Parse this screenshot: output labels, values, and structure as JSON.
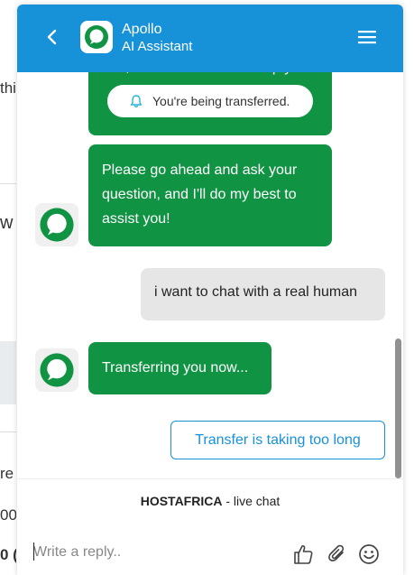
{
  "background_page": {
    "fragments": [
      "thi",
      "w",
      "re",
      "00",
      "0 ("
    ]
  },
  "header": {
    "title": "Apollo",
    "subtitle": "AI Assistant",
    "color": "#1791d8"
  },
  "toast": {
    "text": "You're being transferred."
  },
  "messages": [
    {
      "sender": "bot",
      "text": "Yes, indeed! How can I help you?"
    },
    {
      "sender": "bot",
      "text_lines": [
        "Please go ahead and ask your",
        "question, and I'll do my best to",
        "assist you!"
      ]
    },
    {
      "sender": "user",
      "text": "i want to chat with a real human"
    },
    {
      "sender": "bot",
      "text": "Transferring you now..."
    }
  ],
  "transfer_button": {
    "label": "Transfer is taking too long"
  },
  "footer": {
    "brand": "HOSTAFRICA",
    "brand_suffix": " - live chat",
    "reply_placeholder": "Write a reply..",
    "icons": [
      "thumbs-up-icon",
      "paperclip-icon",
      "emoji-icon"
    ]
  },
  "colors": {
    "bot_bubble": "#109443",
    "user_bubble": "#e6e6e6",
    "accent": "#1791d8"
  }
}
